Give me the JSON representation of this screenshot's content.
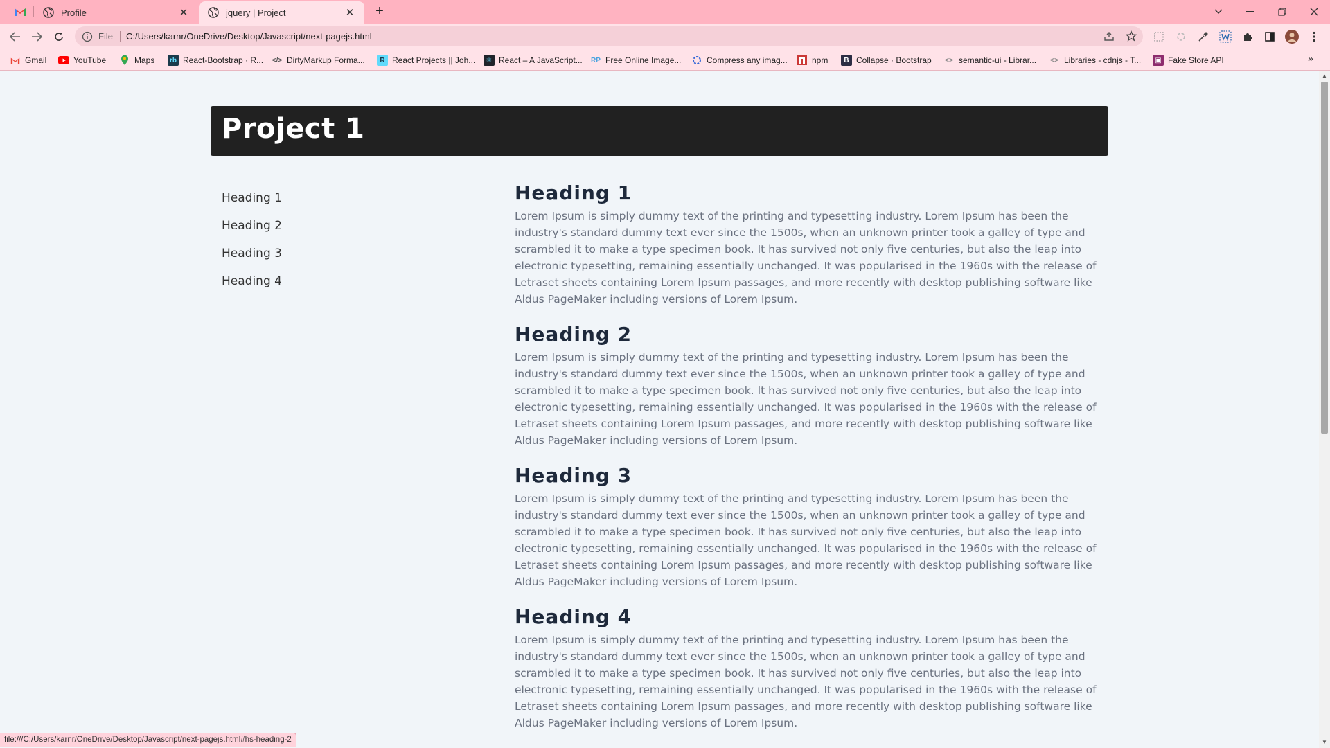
{
  "browser": {
    "tabs": [
      {
        "title": "Profile",
        "active": false
      },
      {
        "title": "jquery | Project",
        "active": true
      }
    ],
    "address": {
      "scheme_label": "File",
      "url": "C:/Users/karnr/OneDrive/Desktop/Javascript/next-pagejs.html"
    },
    "bookmarks": [
      {
        "label": "Gmail",
        "icon": "gmail-icon",
        "color": "#ea4335"
      },
      {
        "label": "YouTube",
        "icon": "youtube-icon",
        "color": "#ff0000"
      },
      {
        "label": "Maps",
        "icon": "maps-icon",
        "color": "#34a853"
      },
      {
        "label": "React-Bootstrap · R...",
        "icon": "react-bootstrap-icon",
        "color": "#1b3a4b"
      },
      {
        "label": "DirtyMarkup Forma...",
        "icon": "code-icon",
        "color": "#555555"
      },
      {
        "label": "React Projects || Joh...",
        "icon": "react-projects-icon",
        "color": "#61dafb"
      },
      {
        "label": "React – A JavaScript...",
        "icon": "react-icon",
        "color": "#20232a"
      },
      {
        "label": "Free Online Image...",
        "icon": "rp-icon",
        "color": "#4aa3df"
      },
      {
        "label": "Compress any imag...",
        "icon": "compress-icon",
        "color": "#3367d6"
      },
      {
        "label": "npm",
        "icon": "npm-icon",
        "color": "#cb3837"
      },
      {
        "label": "Collapse · Bootstrap",
        "icon": "bootstrap-icon",
        "color": "#563d7c"
      },
      {
        "label": "semantic-ui - Librar...",
        "icon": "code-brackets-icon",
        "color": "#888888"
      },
      {
        "label": "Libraries - cdnjs - T...",
        "icon": "code-brackets-icon",
        "color": "#888888"
      },
      {
        "label": "Fake Store API",
        "icon": "fake-store-icon",
        "color": "#8e2c6d"
      }
    ],
    "status_url": "file:///C:/Users/karnr/OneDrive/Desktop/Javascript/next-pagejs.html#hs-heading-2"
  },
  "page": {
    "title": "Project 1",
    "nav": [
      "Heading 1",
      "Heading 2",
      "Heading 3",
      "Heading 4"
    ],
    "sections": [
      {
        "heading": "Heading 1",
        "body": "Lorem Ipsum is simply dummy text of the printing and typesetting industry. Lorem Ipsum has been the industry's standard dummy text ever since the 1500s, when an unknown printer took a galley of type and scrambled it to make a type specimen book. It has survived not only five centuries, but also the leap into electronic typesetting, remaining essentially unchanged. It was popularised in the 1960s with the release of Letraset sheets containing Lorem Ipsum passages, and more recently with desktop publishing software like Aldus PageMaker including versions of Lorem Ipsum."
      },
      {
        "heading": "Heading 2",
        "body": "Lorem Ipsum is simply dummy text of the printing and typesetting industry. Lorem Ipsum has been the industry's standard dummy text ever since the 1500s, when an unknown printer took a galley of type and scrambled it to make a type specimen book. It has survived not only five centuries, but also the leap into electronic typesetting, remaining essentially unchanged. It was popularised in the 1960s with the release of Letraset sheets containing Lorem Ipsum passages, and more recently with desktop publishing software like Aldus PageMaker including versions of Lorem Ipsum."
      },
      {
        "heading": "Heading 3",
        "body": "Lorem Ipsum is simply dummy text of the printing and typesetting industry. Lorem Ipsum has been the industry's standard dummy text ever since the 1500s, when an unknown printer took a galley of type and scrambled it to make a type specimen book. It has survived not only five centuries, but also the leap into electronic typesetting, remaining essentially unchanged. It was popularised in the 1960s with the release of Letraset sheets containing Lorem Ipsum passages, and more recently with desktop publishing software like Aldus PageMaker including versions of Lorem Ipsum."
      },
      {
        "heading": "Heading 4",
        "body": "Lorem Ipsum is simply dummy text of the printing and typesetting industry. Lorem Ipsum has been the industry's standard dummy text ever since the 1500s, when an unknown printer took a galley of type and scrambled it to make a type specimen book. It has survived not only five centuries, but also the leap into electronic typesetting, remaining essentially unchanged. It was popularised in the 1960s with the release of Letraset sheets containing Lorem Ipsum passages, and more recently with desktop publishing software like Aldus PageMaker including versions of Lorem Ipsum."
      }
    ]
  },
  "colors": {
    "tabstrip": "#ffb3c1",
    "toolbar": "#ffe2e8",
    "page_background": "#f1f5f9",
    "header_background": "#212121",
    "heading_text": "#1e293b",
    "body_text": "#6b7280"
  }
}
